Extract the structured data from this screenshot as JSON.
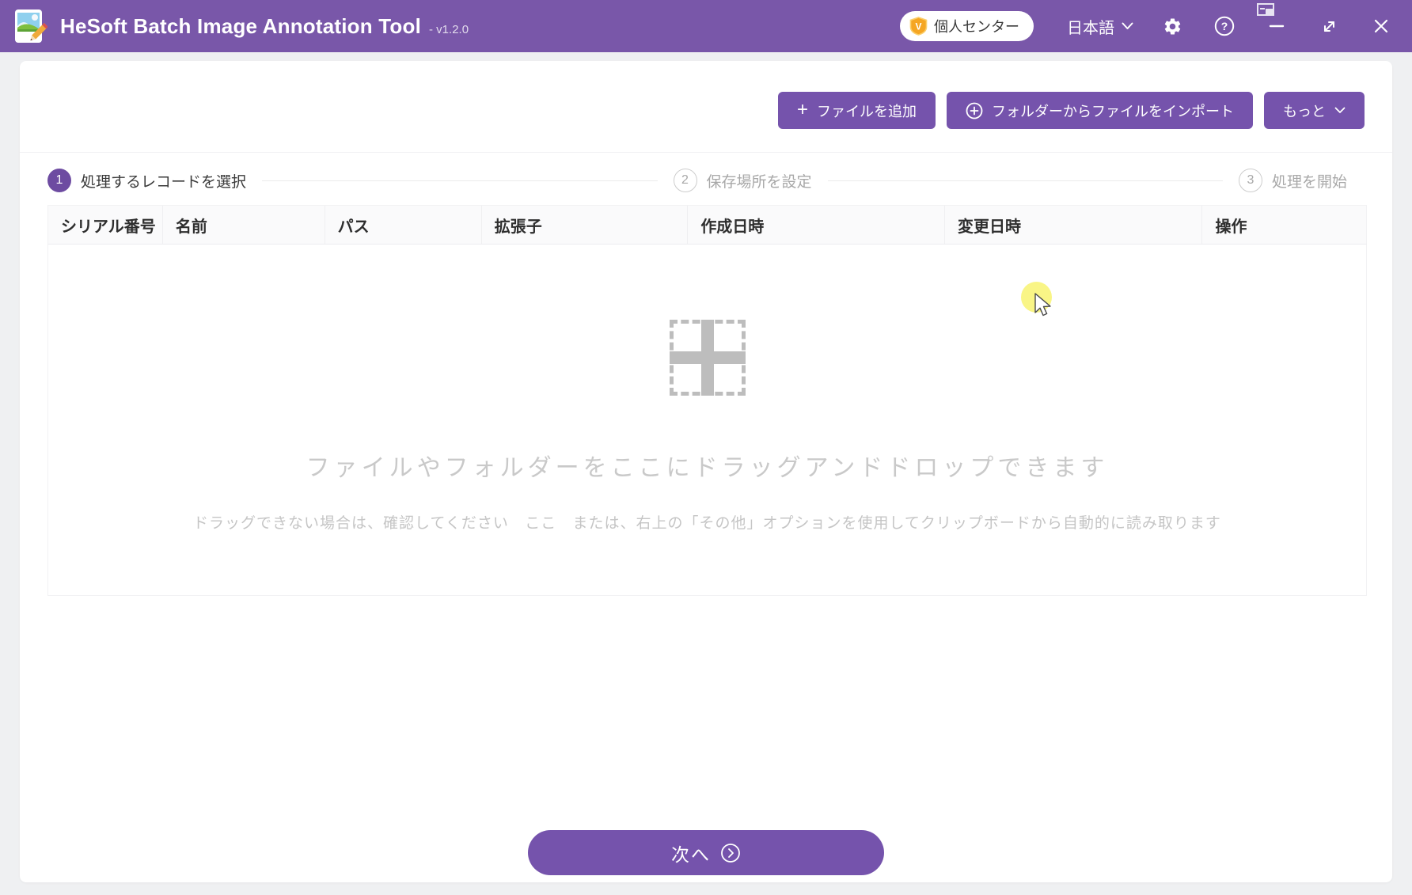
{
  "titlebar": {
    "app_title": "HeSoft Batch Image Annotation Tool",
    "version": "- v1.2.0",
    "personal_center": "個人センター",
    "vip_glyph": "V",
    "language": "日本語",
    "help_glyph": "?"
  },
  "toolbar": {
    "add_files": "ファイルを追加",
    "add_files_plus": "+",
    "import_from_folder": "フォルダーからファイルをインポート",
    "more": "もっと"
  },
  "steps": [
    {
      "number": "1",
      "label": "処理するレコードを選択"
    },
    {
      "number": "2",
      "label": "保存場所を設定"
    },
    {
      "number": "3",
      "label": "処理を開始"
    }
  ],
  "table": {
    "headers": [
      "シリアル番号",
      "名前",
      "パス",
      "拡張子",
      "作成日時",
      "変更日時",
      "操作"
    ],
    "rows": []
  },
  "empty_state": {
    "main_text": "ファイルやフォルダーをここにドラッグアンドドロップできます",
    "hint_prefix": "ドラッグできない場合は、確認してください",
    "hint_link": "ここ",
    "hint_suffix": "または、右上の「その他」オプションを使用してクリップボードから自動的に読み取ります"
  },
  "footer": {
    "next": "次へ"
  },
  "colors": {
    "titlebar_purple": "#7957A9",
    "button_purple": "#7553AC",
    "active_step_purple": "#6D4BA1",
    "vip_gold": "#F5A623",
    "empty_text_gray": "#C9C9C9",
    "cursor_highlight_yellow": "#F8F47C",
    "page_background": "#EFF0F2"
  }
}
